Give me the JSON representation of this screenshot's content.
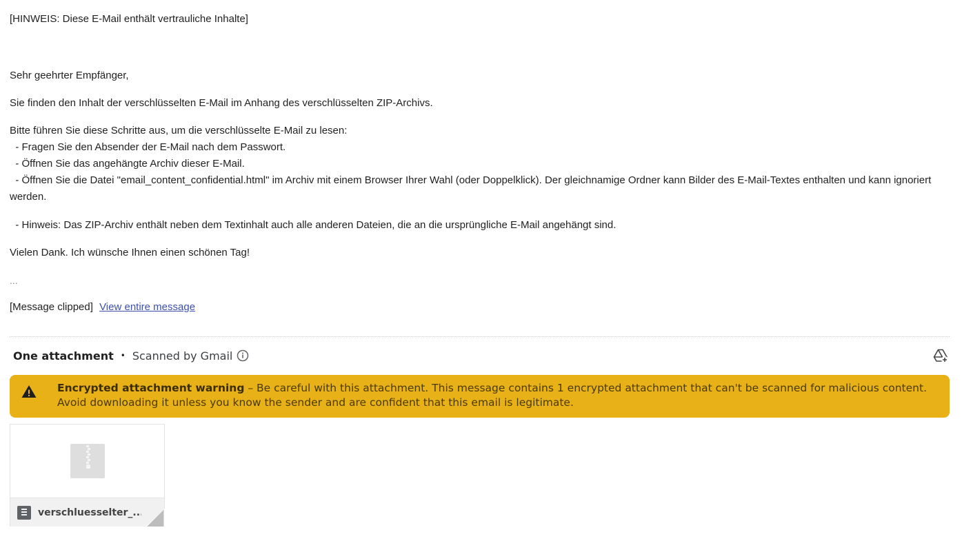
{
  "email": {
    "notice": "[HINWEIS: Diese E-Mail enthält vertrauliche Inhalte]",
    "greeting": "Sehr geehrter Empfänger,",
    "intro": "Sie finden den Inhalt der verschlüsselten E-Mail im Anhang des verschlüsselten ZIP-Archivs.",
    "steps_intro": "Bitte führen Sie diese Schritte aus, um die verschlüsselte E-Mail zu lesen:",
    "step1": "  - Fragen Sie den Absender der E-Mail nach dem Passwort.",
    "step2": "  - Öffnen Sie das angehängte Archiv dieser E-Mail.",
    "step3": "  - Öffnen Sie die Datei \"email_content_confidential.html\" im Archiv mit einem Browser Ihrer Wahl (oder Doppelklick). Der gleichnamige Ordner kann Bilder des E-Mail-Textes enthalten und kann ignoriert werden.",
    "hint": "  - Hinweis: Das ZIP-Archiv enthält neben dem Textinhalt auch alle anderen Dateien, die an die ursprüngliche E-Mail angehängt sind.",
    "closing": "Vielen Dank. Ich wünsche Ihnen einen schönen Tag!",
    "ellipsis": "...",
    "clipped_label": "[Message clipped]",
    "view_entire_link": "View entire message"
  },
  "attachments": {
    "count_label": "One attachment",
    "separator": "•",
    "scanned_label": "Scanned by Gmail",
    "info_icon": "info-icon",
    "add_to_drive_icon": "add-to-drive-icon"
  },
  "warning": {
    "title": "Encrypted attachment warning",
    "dash": " – ",
    "message": "Be careful with this attachment. This message contains 1 encrypted attachment that can't be scanned for malicious content. Avoid downloading it unless you know the sender and are confident that this email is legitimate.",
    "icon": "warning-triangle-icon",
    "background_color": "#e8b117"
  },
  "attachment_card": {
    "file_name": "verschluesselter_...",
    "preview_icon": "zip-file-icon",
    "type_icon": "archive-file-icon"
  },
  "colors": {
    "link": "#3c4fb0",
    "text": "#222222"
  }
}
